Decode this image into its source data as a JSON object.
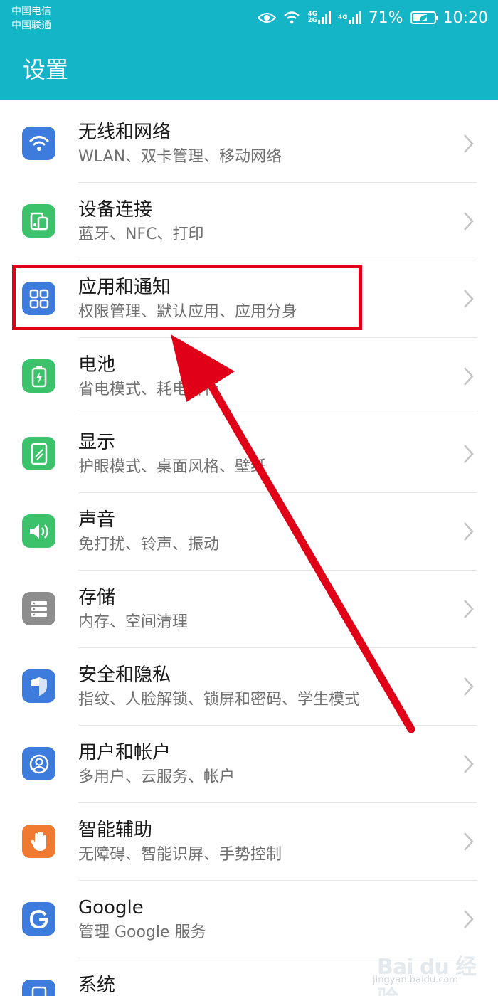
{
  "status_bar": {
    "carrier_1": "中国电信",
    "carrier_2": "中国联通",
    "battery_text": "71%",
    "battery_level": 0.71,
    "time": "10:20",
    "net_tag_1a": "4G",
    "net_tag_1b": "2G",
    "net_tag_2": "4G"
  },
  "header": {
    "title": "设置"
  },
  "colors": {
    "header_bg": "#14b5c7",
    "blue_icon": "#3d7bdc",
    "green_icon": "#3cc26a",
    "gray_icon": "#8d8d8d",
    "orange_icon": "#f07a30",
    "highlight": "#e00018"
  },
  "settings": [
    {
      "title": "无线和网络",
      "subtitle": "WLAN、双卡管理、移动网络",
      "icon": "wifi-icon"
    },
    {
      "title": "设备连接",
      "subtitle": "蓝牙、NFC、打印",
      "icon": "device-connect-icon"
    },
    {
      "title": "应用和通知",
      "subtitle": "权限管理、默认应用、应用分身",
      "icon": "apps-grid-icon"
    },
    {
      "title": "电池",
      "subtitle": "省电模式、耗电排行",
      "icon": "battery-icon"
    },
    {
      "title": "显示",
      "subtitle": "护眼模式、桌面风格、壁纸",
      "icon": "display-icon"
    },
    {
      "title": "声音",
      "subtitle": "免打扰、铃声、振动",
      "icon": "sound-icon"
    },
    {
      "title": "存储",
      "subtitle": "内存、空间清理",
      "icon": "storage-icon"
    },
    {
      "title": "安全和隐私",
      "subtitle": "指纹、人脸解锁、锁屏和密码、学生模式",
      "icon": "shield-icon"
    },
    {
      "title": "用户和帐户",
      "subtitle": "多用户、云服务、帐户",
      "icon": "user-icon"
    },
    {
      "title": "智能辅助",
      "subtitle": "无障碍、智能识屏、手势控制",
      "icon": "hand-icon"
    },
    {
      "title": "Google",
      "subtitle": "管理 Google 服务",
      "icon": "google-icon"
    },
    {
      "title": "系统",
      "subtitle": "",
      "icon": "system-icon"
    }
  ],
  "watermark": {
    "brand": "Bai du 经验",
    "url": "jingyan.baidu.com"
  }
}
